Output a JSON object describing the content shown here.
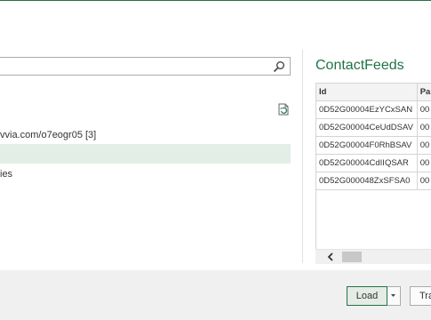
{
  "navigator": {
    "search": {
      "value": "",
      "placeholder": ""
    },
    "items": [
      {
        "label": "vvia.com/o7eogr05 [3]"
      },
      {
        "label": ""
      },
      {
        "label": "ies"
      }
    ]
  },
  "preview": {
    "title": "ContactFeeds",
    "columns": [
      "Id",
      "Pa"
    ],
    "rows": [
      [
        "0D52G00004EzYCxSAN",
        "00"
      ],
      [
        "0D52G00004CeUdDSAV",
        "00"
      ],
      [
        "0D52G00004F0RhBSAV",
        "00"
      ],
      [
        "0D52G00004CdIIQSAR",
        "00"
      ],
      [
        "0D52G000048ZxSFSA0",
        "00"
      ]
    ]
  },
  "footer": {
    "load_label": "Load",
    "transform_label": "Tra"
  },
  "colors": {
    "accent": "#217346",
    "selected_row": "#e3efe6"
  },
  "icons": [
    "search-icon",
    "refresh-icon",
    "dropdown-arrow-icon",
    "scroll-left-icon"
  ]
}
